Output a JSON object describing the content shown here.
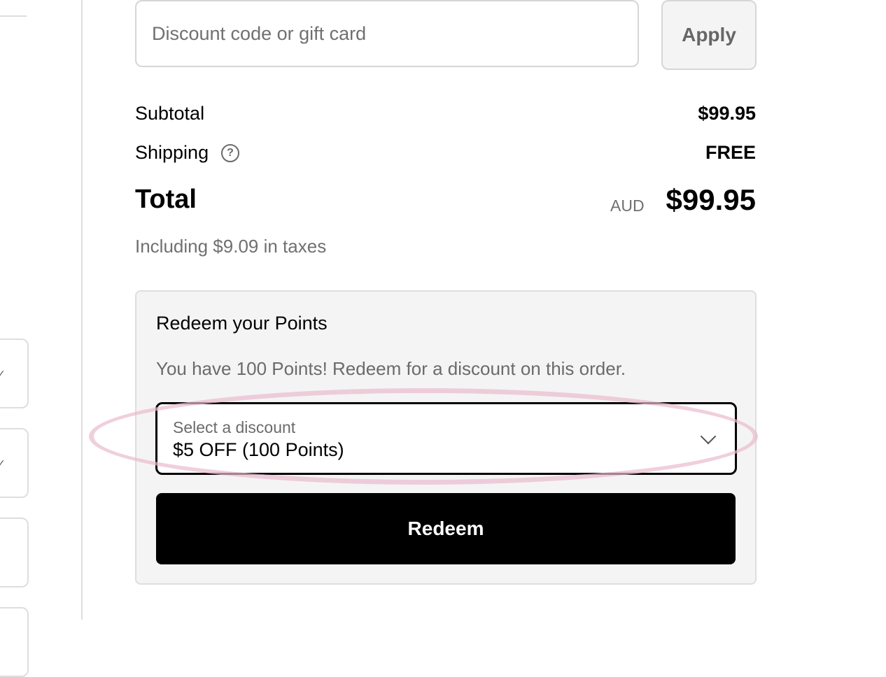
{
  "discount": {
    "placeholder": "Discount code or gift card",
    "apply_label": "Apply"
  },
  "summary": {
    "subtotal_label": "Subtotal",
    "subtotal_value": "$99.95",
    "shipping_label": "Shipping",
    "shipping_help_icon": "question-circle-icon",
    "shipping_help_glyph": "?",
    "shipping_value": "FREE",
    "total_label": "Total",
    "total_currency": "AUD",
    "total_value": "$99.95",
    "tax_note": "Including $9.09 in taxes"
  },
  "points": {
    "title": "Redeem your Points",
    "description": "You have 100 Points! Redeem for a discount on this order.",
    "select_caption": "Select a discount",
    "select_value": "$5 OFF (100 Points)",
    "redeem_label": "Redeem"
  },
  "left_panel": {
    "check_glyph": "✓"
  },
  "colors": {
    "highlight": "#eabbcf",
    "button_bg": "#000000",
    "panel_bg": "#f4f4f4"
  }
}
